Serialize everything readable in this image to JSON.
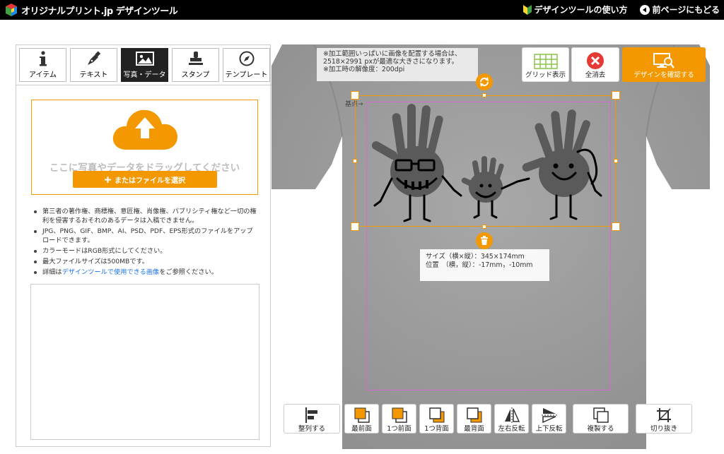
{
  "header": {
    "logo_text": "オリジナルプリント.jp デザインツール",
    "howto_label": "デザインツールの使い方",
    "back_label": "前ページにもどる"
  },
  "tabs": [
    {
      "label": "アイテム",
      "icon": "info-icon"
    },
    {
      "label": "テキスト",
      "icon": "pen-icon"
    },
    {
      "label": "写真・データ",
      "icon": "image-icon",
      "active": true
    },
    {
      "label": "スタンプ",
      "icon": "stamp-icon"
    },
    {
      "label": "テンプレート",
      "icon": "compass-icon"
    }
  ],
  "upload": {
    "drop_text": "ここに写真やデータをドラッグしてください",
    "file_button": "またはファイルを選択"
  },
  "notes": [
    "第三者の著作権、商標権、意匠権、肖像権、パブリシティ権など一切の権利を侵害するおそれのあるデータは入稿できません。",
    "JPG、PNG、GIF、BMP、AI、PSD、PDF、EPS形式のファイルをアップロードできます。",
    "カラーモードはRGB形式にしてください。",
    "最大ファイルサイズは500MBです。"
  ],
  "note_link": {
    "prefix": "詳細は",
    "link": "デザインツールで使用できる画像",
    "suffix": "をご参照ください。"
  },
  "canvas": {
    "info_lines": [
      "※加工範囲いっぱいに画像を配置する場合は、",
      "2518×2991 pxが最適な大きさになります。",
      "※加工時の解像度：200dpi"
    ],
    "kijun_label": "基点→",
    "size_line": "サイズ（横×縦）：345×174mm",
    "position_line": "位置　（横，縦）：-17mm，-10mm"
  },
  "tools": {
    "grid": "グリッド表示",
    "clear": "全消去",
    "confirm": "デザインを確認する"
  },
  "bottom_tools": [
    {
      "label": "整列する",
      "icon": "align-icon"
    },
    {
      "label": "最前面",
      "icon": "bring-front-icon"
    },
    {
      "label": "1つ前面",
      "icon": "forward-icon"
    },
    {
      "label": "1つ背面",
      "icon": "backward-icon"
    },
    {
      "label": "最背面",
      "icon": "send-back-icon"
    },
    {
      "label": "左右反転",
      "icon": "flip-horizontal-icon"
    },
    {
      "label": "上下反転",
      "icon": "flip-vertical-icon"
    },
    {
      "label": "複製する",
      "icon": "duplicate-icon"
    },
    {
      "label": "切り抜き",
      "icon": "crop-icon"
    }
  ],
  "colors": {
    "accent": "#f39800",
    "selection": "#d36bd3",
    "shirt": "#9e9e9e"
  }
}
